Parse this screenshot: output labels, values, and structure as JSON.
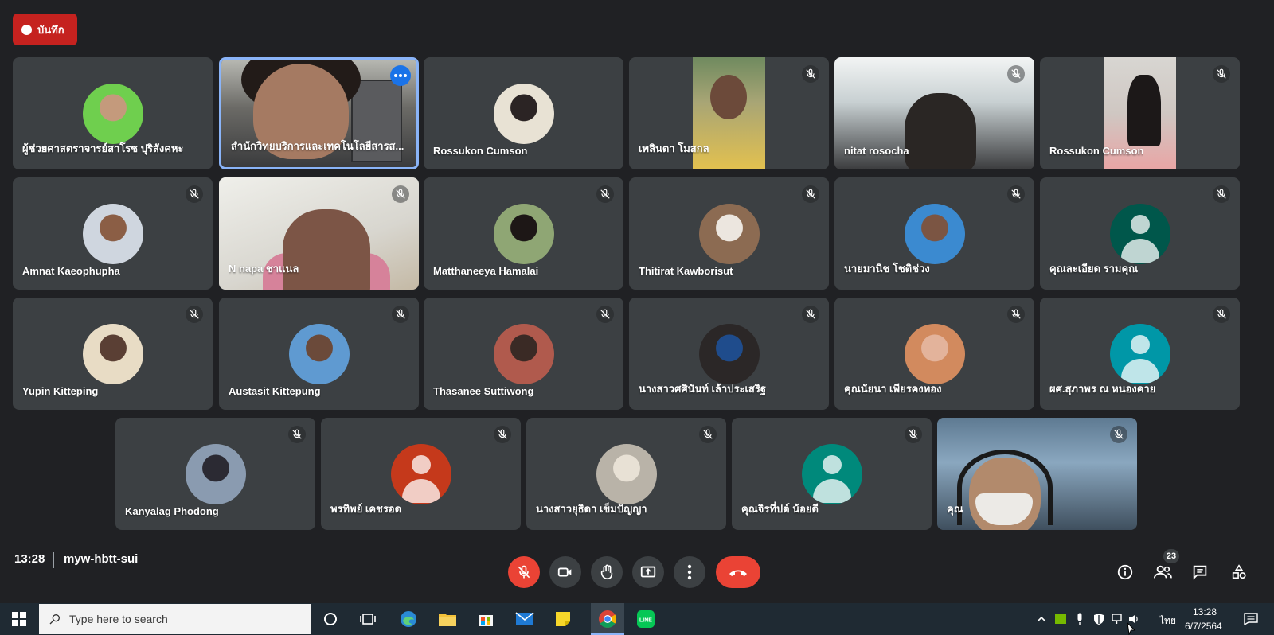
{
  "recording": {
    "label": "บันทึก"
  },
  "tiles": [
    {
      "name": "ผู้ช่วยศาสตราจารย์สาโรช ปุริสังคหะ"
    },
    {
      "name": "สำนักวิทยบริการและเทคโนโลยีสารส..."
    },
    {
      "name": "Rossukon Cumson"
    },
    {
      "name": "เพลินตา โมสกล"
    },
    {
      "name": "nitat rosocha"
    },
    {
      "name": "Rossukon Cumson"
    },
    {
      "name": "Amnat Kaeophupha"
    },
    {
      "name": "N napa ชาแนล"
    },
    {
      "name": "Matthaneeya Hamalai"
    },
    {
      "name": "Thitirat Kawborisut"
    },
    {
      "name": "นายมานิช โชติช่วง"
    },
    {
      "name": "คุณละเอียด รามคุณ"
    },
    {
      "name": "Yupin Kitteping"
    },
    {
      "name": "Austasit Kittepung"
    },
    {
      "name": "Thasanee Suttiwong"
    },
    {
      "name": "นางสาวศศินันท์ เล้าประเสริฐ"
    },
    {
      "name": "คุณนัยนา เพียรคงทอง"
    },
    {
      "name": "ผศ.สุภาพร ณ หนองคาย"
    },
    {
      "name": "Kanyalag Phodong"
    },
    {
      "name": "พรทิพย์ เคชรอด"
    },
    {
      "name": "นางสาวยุธิดา เข็มปัญญา"
    },
    {
      "name": "คุณจิรที่ปต์ น้อยดี"
    },
    {
      "name": "คุณ"
    }
  ],
  "meeting": {
    "time": "13:28",
    "code": "myw-hbtt-sui"
  },
  "participants_count": "23",
  "taskbar": {
    "search_placeholder": "Type here to search",
    "language": "ไทย",
    "clock_time": "13:28",
    "clock_date": "6/7/2564"
  },
  "colors": {
    "background": "#202124",
    "tile": "#3c4043",
    "danger": "#ea4335",
    "accent": "#8ab4f8"
  }
}
